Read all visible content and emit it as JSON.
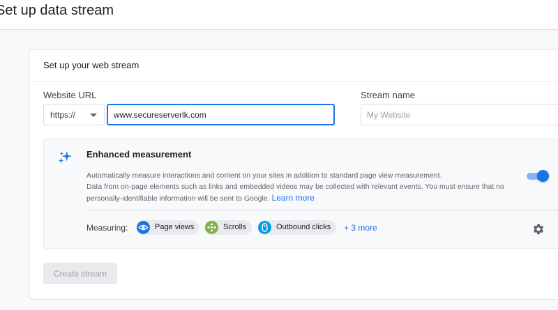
{
  "header": {
    "title": "Set up data stream"
  },
  "card": {
    "title": "Set up your web stream"
  },
  "form": {
    "website_url_label": "Website URL",
    "protocol": "https://",
    "url_value": "www.secureserverlk.com",
    "stream_name_label": "Stream name",
    "stream_name_placeholder": "My Website"
  },
  "enhanced": {
    "title": "Enhanced measurement",
    "desc_line1": "Automatically measure interactions and content on your sites in addition to standard page view measurement.",
    "desc_line2": "Data from on-page elements such as links and embedded videos may be collected with relevant events. You must ensure that no personally-identifiable information will be sent to Google.",
    "learn_more": "Learn more",
    "toggle_on": true,
    "measuring_label": "Measuring:",
    "chips": [
      {
        "label": "Page views",
        "icon": "eye-icon",
        "color": "#1a73e8"
      },
      {
        "label": "Scrolls",
        "icon": "scroll-icon",
        "color": "#7cb342"
      },
      {
        "label": "Outbound clicks",
        "icon": "mouse-icon",
        "color": "#039be5"
      }
    ],
    "more": "+ 3 more"
  },
  "actions": {
    "create_label": "Create stream"
  },
  "colors": {
    "accent": "#1a73e8",
    "disabled_bg": "#e8eaed",
    "disabled_text": "#9aa0a6"
  }
}
